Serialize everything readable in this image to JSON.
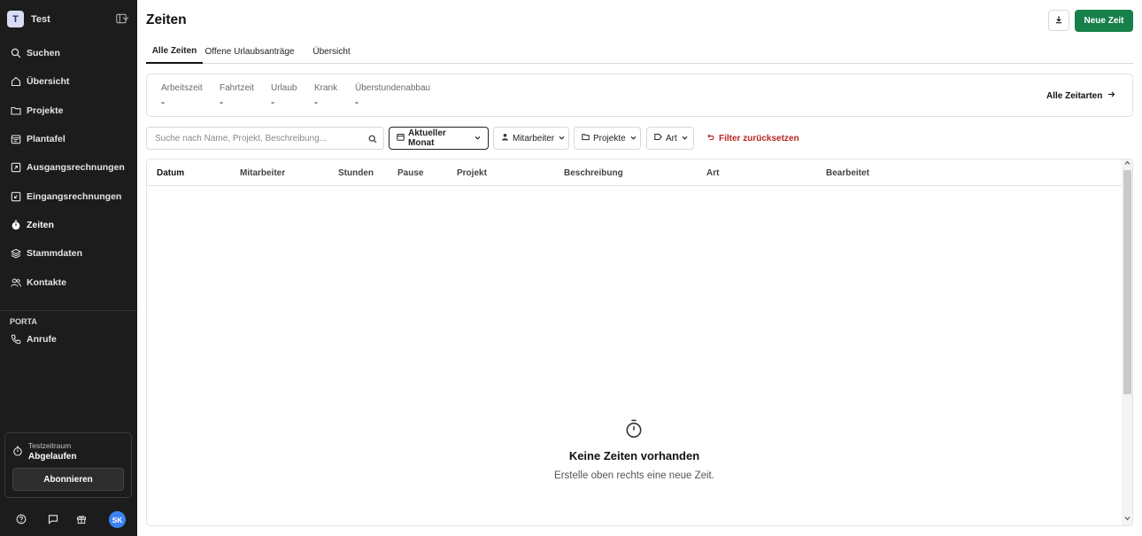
{
  "sidebar": {
    "workspace": {
      "initial": "T",
      "name": "Test"
    },
    "items": [
      {
        "label": "Suchen",
        "icon": "search-icon"
      },
      {
        "label": "Übersicht",
        "icon": "home-icon"
      },
      {
        "label": "Projekte",
        "icon": "folder-icon"
      },
      {
        "label": "Plantafel",
        "icon": "calendar-icon"
      },
      {
        "label": "Ausgangsrechnungen",
        "icon": "invoice-out-icon"
      },
      {
        "label": "Eingangsrechnungen",
        "icon": "invoice-in-icon"
      },
      {
        "label": "Zeiten",
        "icon": "stopwatch-icon"
      },
      {
        "label": "Stammdaten",
        "icon": "layers-icon"
      },
      {
        "label": "Kontakte",
        "icon": "users-icon"
      }
    ],
    "section_label": "PORTA",
    "section_items": [
      {
        "label": "Anrufe",
        "icon": "phone-icon"
      }
    ],
    "trial": {
      "line1": "Testzeitraum",
      "line2": "Abgelaufen",
      "button": "Abonnieren"
    },
    "user_initials": "SK"
  },
  "header": {
    "title": "Zeiten",
    "primary_button": "Neue Zeit"
  },
  "tabs": [
    {
      "label": "Alle Zeiten",
      "active": true
    },
    {
      "label": "Offene Urlaubsanträge",
      "active": false
    },
    {
      "label": "Übersicht",
      "active": false
    }
  ],
  "summary": {
    "stats": [
      {
        "label": "Arbeitszeit",
        "value": "-"
      },
      {
        "label": "Fahrtzeit",
        "value": "-"
      },
      {
        "label": "Urlaub",
        "value": "-"
      },
      {
        "label": "Krank",
        "value": "-"
      },
      {
        "label": "Überstundenabbau",
        "value": "-"
      }
    ],
    "link": "Alle Zeitarten"
  },
  "filters": {
    "search_placeholder": "Suche nach Name, Projekt, Beschreibung...",
    "period": "Aktueller Monat",
    "employee": "Mitarbeiter",
    "projects": "Projekte",
    "type": "Art",
    "reset": "Filter zurücksetzen"
  },
  "table": {
    "columns": [
      "Datum",
      "Mitarbeiter",
      "Stunden",
      "Pause",
      "Projekt",
      "Beschreibung",
      "Art",
      "Bearbeitet"
    ],
    "rows": []
  },
  "empty_state": {
    "title": "Keine Zeiten vorhanden",
    "subtitle": "Erstelle oben rechts eine neue Zeit."
  },
  "colors": {
    "sidebar_bg": "#1c1c1c",
    "primary": "#17804a",
    "reset": "#b92424"
  }
}
